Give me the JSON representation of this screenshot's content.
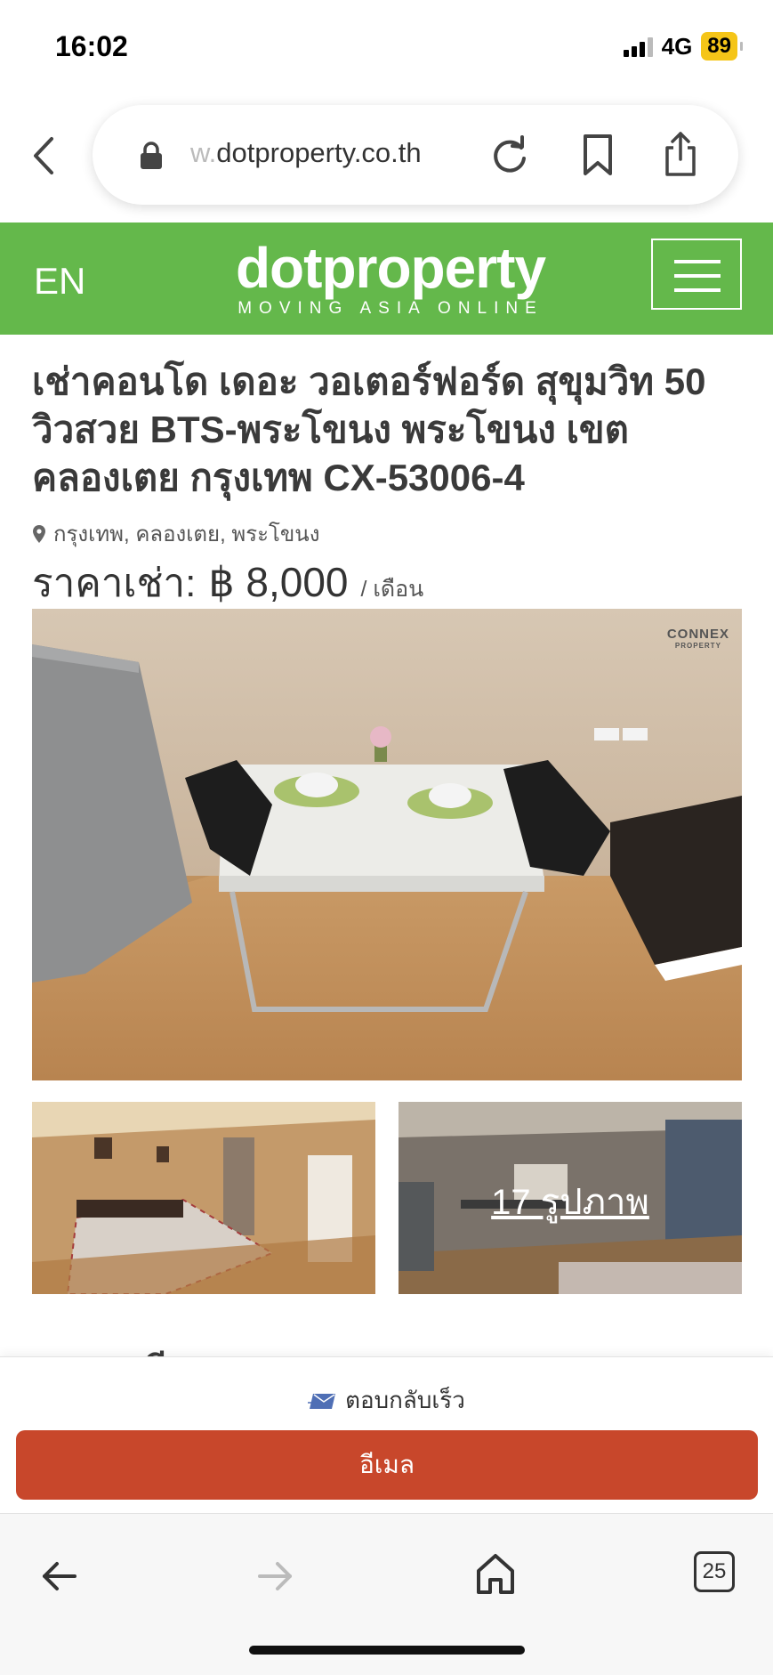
{
  "status_bar": {
    "time": "16:02",
    "network": "4G",
    "battery": "89"
  },
  "browser": {
    "url_prefix": "w.",
    "url_domain": "dotproperty.co.th",
    "tabs_count": "25",
    "icons": [
      "back-icon",
      "lock-icon",
      "reload-icon",
      "bookmark-icon",
      "share-icon",
      "forward-icon",
      "home-icon",
      "tabs-icon"
    ]
  },
  "header": {
    "lang": "EN",
    "logo": "dotproperty",
    "tagline": "MOVING ASIA ONLINE",
    "color": "#64b84b"
  },
  "listing": {
    "title": "เช่าคอนโด เดอะ วอเตอร์ฟอร์ด สุขุมวิท 50 วิวสวย BTS-พระโขนง พระโขนง เขตคลองเตย กรุงเทพ CX-53006-4",
    "location": "กรุงเทพ, คลองเตย, พระโขนง",
    "price_label": "ราคาเช่า:",
    "price_value": "฿ 8,000",
    "price_unit": "/ เดือน",
    "photo_count": "17 รูปภาพ",
    "watermark": "CONNEX",
    "watermark_sub": "PROPERTY"
  },
  "contact": {
    "section_heading_partial": "รายละเอียด",
    "quick_reply": "ตอบกลับเร็ว",
    "email_button": "อีเมล",
    "button_color": "#c8472b"
  }
}
